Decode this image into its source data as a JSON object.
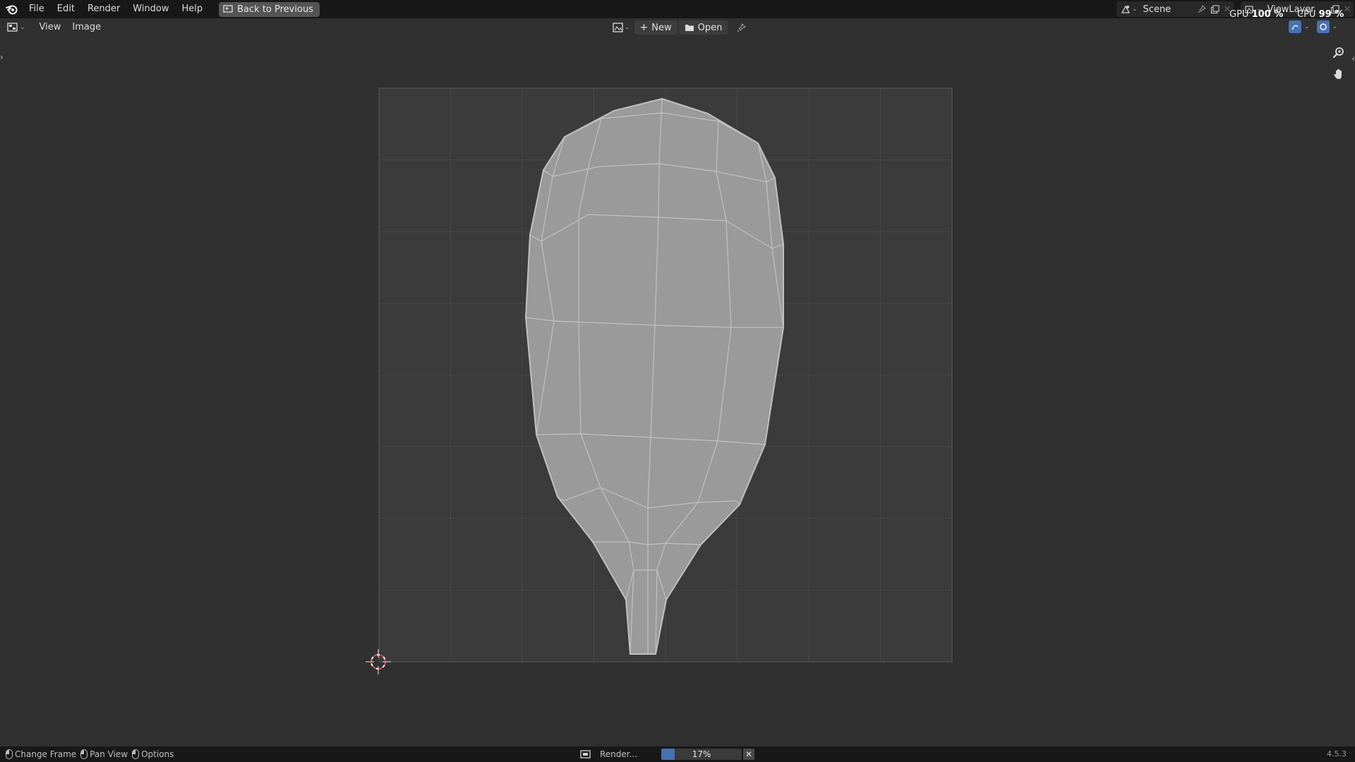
{
  "menubar": {
    "items": [
      "File",
      "Edit",
      "Render",
      "Window",
      "Help"
    ],
    "back_button": "Back to Previous",
    "scene": "Scene",
    "view_layer": "ViewLayer"
  },
  "performance": {
    "gpu_label": "GPU",
    "gpu_value": "100 %",
    "cpu_label": "CPU",
    "cpu_value": "99 %"
  },
  "editor_header": {
    "menus": [
      "View",
      "Image"
    ],
    "new_label": "New",
    "open_label": "Open"
  },
  "statusbar": {
    "hints": [
      "Change Frame",
      "Pan View",
      "Options"
    ],
    "job_label": "Render...",
    "progress": 0.17,
    "progress_text": "17%",
    "version": "4.5.3"
  },
  "colors": {
    "background": "#303030",
    "bar": "#181818",
    "render_area": "#3b3b3b",
    "mesh_fill": "#9a9a9a",
    "mesh_edge": "#c0c0c0",
    "progress": "#4772b3"
  },
  "icons": [
    "blender-logo-icon",
    "back-icon",
    "scene-icon",
    "pin-icon",
    "new-scene-icon",
    "view-layer-icon",
    "editor-type-icon",
    "image-icon",
    "plus-icon",
    "folder-icon",
    "zoom-icon",
    "hand-icon",
    "cursor-icon",
    "render-icon",
    "close-icon",
    "overlay-icon"
  ]
}
